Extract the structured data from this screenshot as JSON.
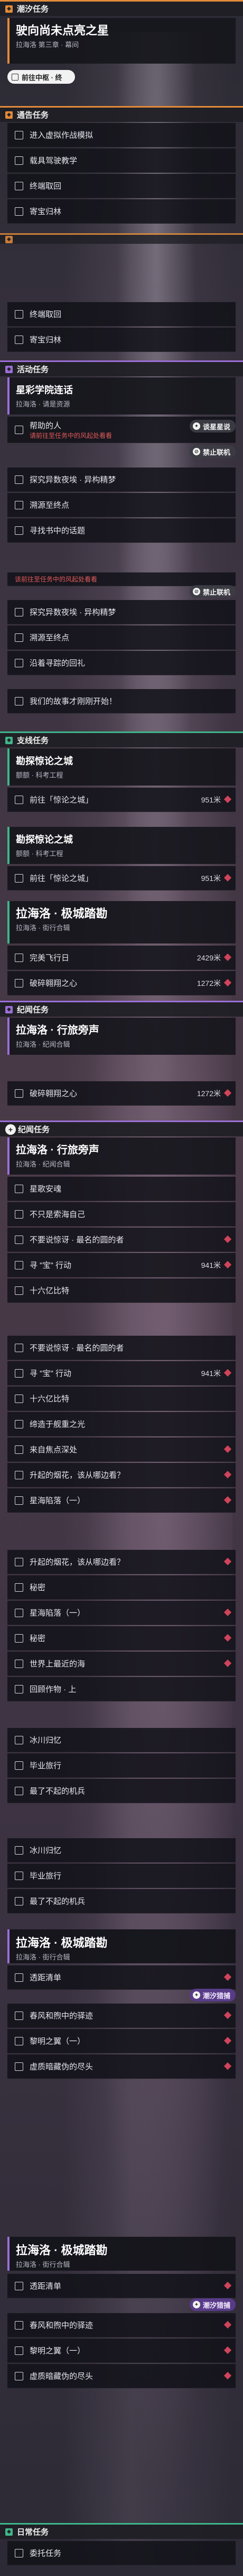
{
  "sections": {
    "s1": "潮汐任务",
    "s2": "通告任务",
    "s3": "活动任务",
    "s4": "支线任务",
    "s5": "纪闻任务",
    "s6": "纪闻任务",
    "s7": "日常任务"
  },
  "quest1": {
    "title": "驶向尚未点亮之星",
    "sub": "拉海洛 第三章 · 幕间",
    "pill": "前往中枢 · 终"
  },
  "notice": {
    "items": [
      "进入虚拟作战模拟",
      "载具驾驶教学",
      "终端取回",
      "寄宝归林"
    ]
  },
  "notice2": {
    "items": [
      "终端取回",
      "寄宝归林"
    ]
  },
  "event": {
    "title": "星彩学院连话",
    "sub": "拉海洛 · 请是资源",
    "items": [
      {
        "text": "帮助的人",
        "red": false
      },
      {
        "text": "探究异数夜埃 · 异构精梦",
        "red": false
      },
      {
        "text": "溯源至终点",
        "red": false
      },
      {
        "text": "寻找书中的话题",
        "red": false
      },
      {
        "text": "探究异数夜埃 · 异构精梦",
        "red": false
      },
      {
        "text": "溯源至终点",
        "red": false
      },
      {
        "text": "沿着寻踪的回礼",
        "red": false
      },
      {
        "text": "我们的故事才刚刚开始！",
        "red": false
      }
    ],
    "red_note": "请前往至任务中的风起处看看",
    "red_note2": "该前往至任务中的风起处看看",
    "badge1": "谈星星说",
    "badge2": "禁止联机"
  },
  "side1": {
    "title": "勘探惊论之城",
    "sub": "额额 · 科考工程",
    "items": [
      {
        "text": "前往「惊论之城」",
        "dist": "951米"
      }
    ]
  },
  "side2": {
    "title": "勘探惊论之城",
    "sub": "额额 · 科考工程",
    "items": [
      {
        "text": "前往「惊论之城」",
        "dist": "951米"
      }
    ]
  },
  "side3": {
    "title": "拉海洛 · 极城踏勘",
    "sub": "拉海洛 · 街行合辑",
    "items": [
      {
        "text": "完美飞行日",
        "dist": "2429米"
      },
      {
        "text": "破碎翱翔之心",
        "dist": "1272米"
      }
    ]
  },
  "lore1": {
    "title": "拉海洛 · 行旅旁声",
    "sub": "拉海洛 · 纪闻合辑",
    "items": [
      {
        "text": "破碎翱翔之心",
        "dist": "1272米"
      }
    ]
  },
  "lore2": {
    "title": "拉海洛 · 行旅旁声",
    "sub": "拉海洛 · 纪闻合辑",
    "items": [
      {
        "text": "星歌安魂",
        "dist": ""
      },
      {
        "text": "不只是索海自己",
        "dist": ""
      },
      {
        "text": "不要说惊讶 · 最名的圆的者",
        "dist": ""
      },
      {
        "text": "寻 \"宝\" 行动",
        "dist": "941米"
      },
      {
        "text": "十六亿比特",
        "dist": ""
      },
      {
        "text": "不要说惊讶 · 最名的圆的者",
        "dist": ""
      },
      {
        "text": "寻 \"宝\" 行动",
        "dist": "941米"
      },
      {
        "text": "十六亿比特",
        "dist": ""
      },
      {
        "text": "缔造于舰重之光",
        "dist": ""
      },
      {
        "text": "来自焦点深处",
        "dist": ""
      },
      {
        "text": "升起的烟花，该从哪边看？",
        "dist": ""
      },
      {
        "text": "星海陷落（一）",
        "dist": ""
      },
      {
        "text": "升起的烟花，该从哪边看？",
        "dist": ""
      },
      {
        "text": "秘密",
        "dist": ""
      },
      {
        "text": "星海陷落（一）",
        "dist": ""
      },
      {
        "text": "秘密",
        "dist": ""
      },
      {
        "text": "世界上最近的海",
        "dist": ""
      },
      {
        "text": "回顾作物 · 上",
        "dist": ""
      },
      {
        "text": "冰川归忆",
        "dist": ""
      },
      {
        "text": "毕业旅行",
        "dist": ""
      },
      {
        "text": "最了不起的机兵",
        "dist": ""
      },
      {
        "text": "冰川归忆",
        "dist": ""
      },
      {
        "text": "毕业旅行",
        "dist": ""
      },
      {
        "text": "最了不起的机兵",
        "dist": ""
      }
    ]
  },
  "side4": {
    "title": "拉海洛 · 极城踏勘",
    "sub": "拉海洛 · 街行合辑",
    "badge": "潮汐猎捕",
    "items": [
      {
        "text": "透距清单"
      },
      {
        "text": "春风和煦中的驿迹"
      },
      {
        "text": "黎明之翼（一）"
      },
      {
        "text": "虚质暗藏伪的尽头"
      }
    ]
  },
  "side5": {
    "title": "拉海洛 · 极城踏勘",
    "sub": "拉海洛 · 街行合辑",
    "badge": "潮汐猎捕",
    "items": [
      {
        "text": "透距清单"
      },
      {
        "text": "春风和煦中的驿迹"
      },
      {
        "text": "黎明之翼（一）"
      },
      {
        "text": "虚质暗藏伪的尽头"
      }
    ]
  },
  "daily": {
    "items": [
      "委托任务"
    ]
  }
}
